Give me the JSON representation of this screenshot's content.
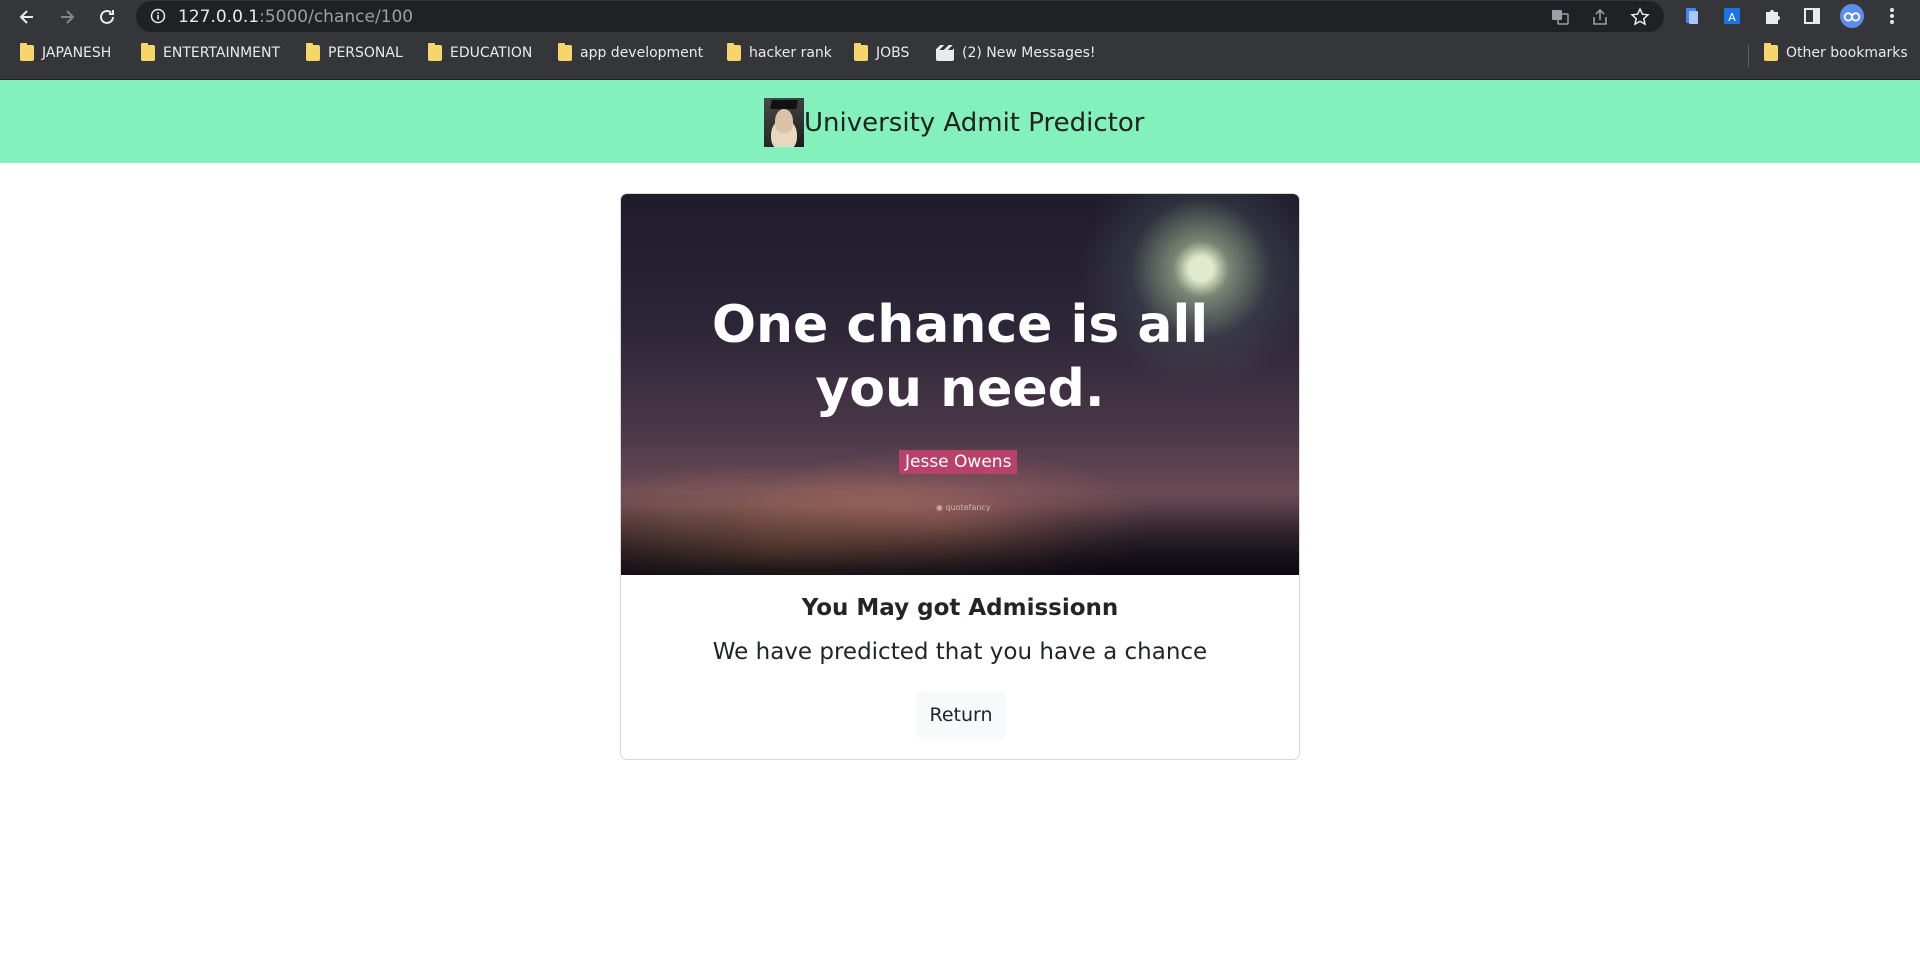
{
  "browser": {
    "url_host": "127.0.0.1",
    "url_rest": ":5000/chance/100",
    "icons": [
      "back-arrow-icon",
      "forward-arrow-icon",
      "reload-icon",
      "info-icon",
      "translate-icon",
      "share-icon",
      "star-icon",
      "extension-icon",
      "puzzle-icon",
      "sidepanel-icon",
      "profile-avatar-icon",
      "kebab-menu-icon"
    ]
  },
  "bookmarks": {
    "items": [
      {
        "label": "JAPANESH"
      },
      {
        "label": "ENTERTAINMENT"
      },
      {
        "label": "PERSONAL"
      },
      {
        "label": "EDUCATION"
      },
      {
        "label": "app development"
      },
      {
        "label": "hacker rank"
      },
      {
        "label": "JOBS"
      },
      {
        "label": "(2) New Messages!"
      }
    ],
    "other": "Other bookmarks"
  },
  "navbar": {
    "brand": "University Admit Predictor",
    "background": "#84f1bc"
  },
  "card": {
    "image": {
      "quote_line1": "One chance is all",
      "quote_line2": "you need.",
      "author": "Jesse Owens",
      "watermark": "quotefancy"
    },
    "title": "You May got Admissionn",
    "text": "We have predicted that you have a chance",
    "button": "Return"
  }
}
